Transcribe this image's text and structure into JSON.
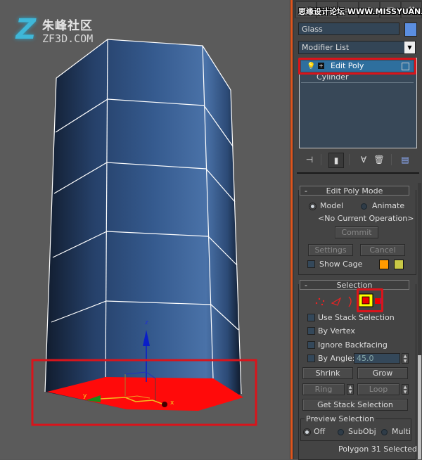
{
  "watermark": {
    "logo_glyph": "Z",
    "title_cn": "朱峰社区",
    "domain": "ZF3D.COM",
    "panel_overlay": "思缘设计论坛 WWW.MISSYUAN.COM"
  },
  "viewport": {
    "axis_labels": {
      "x": "x",
      "y": "y",
      "z": "z"
    },
    "colors": {
      "mesh_dark": "#16243a",
      "mesh_light": "#4a72a8",
      "wire": "#ffffff",
      "selected_face": "#ff0a0a",
      "highlight_box": "#d9141b"
    }
  },
  "command_panel": {
    "tabs": [
      "create-icon",
      "modify-icon",
      "hierarchy-icon",
      "motion-icon",
      "display-icon",
      "utilities-icon"
    ],
    "object_name": "Glass",
    "object_color": "#5b8ee0",
    "modifier_list_label": "Modifier List",
    "stack": [
      {
        "label": "Edit Poly",
        "selected": true
      },
      {
        "label": "Cylinder",
        "selected": false
      }
    ],
    "stack_tools": [
      "pin-stack-icon",
      "show-end-result-icon",
      "make-unique-icon",
      "remove-modifier-icon",
      "configure-modifier-sets-icon"
    ],
    "edit_poly_mode": {
      "title": "Edit Poly Mode",
      "collapse": "-",
      "radio_model": "Model",
      "radio_animate": "Animate",
      "selected_mode": "Model",
      "current_operation": "<No Current Operation>",
      "commit_label": "Commit",
      "settings_label": "Settings",
      "cancel_label": "Cancel",
      "show_cage_label": "Show Cage",
      "show_cage_checked": false,
      "cage_colors": [
        "#ff9a00",
        "#c8c846"
      ]
    },
    "selection": {
      "title": "Selection",
      "collapse": "-",
      "subobject_levels": [
        "Vertex",
        "Edge",
        "Border",
        "Polygon",
        "Element"
      ],
      "active_level": "Polygon",
      "use_stack_selection": "Use Stack Selection",
      "by_vertex": "By Vertex",
      "ignore_backfacing": "Ignore Backfacing",
      "by_angle": "By Angle:",
      "angle_value": "45.0",
      "shrink": "Shrink",
      "grow": "Grow",
      "ring": "Ring",
      "loop": "Loop",
      "get_stack_selection": "Get Stack Selection",
      "preview_selection": {
        "title": "Preview Selection",
        "options": [
          "Off",
          "SubObj",
          "Multi"
        ],
        "selected": "Off"
      },
      "status": "Polygon 31 Selected"
    }
  }
}
